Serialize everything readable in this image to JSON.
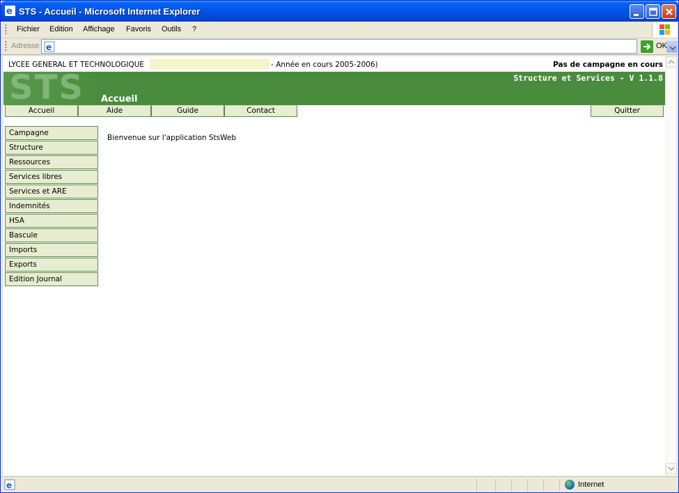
{
  "window": {
    "title": "STS - Accueil - Microsoft Internet Explorer"
  },
  "menu": {
    "items": [
      "Fichier",
      "Edition",
      "Affichage",
      "Favoris",
      "Outils",
      "?"
    ]
  },
  "address_bar": {
    "label": "Adresse",
    "value": "",
    "go_label": "OK"
  },
  "page": {
    "school": "LYCEE GENERAL ET TECHNOLOGIQUE",
    "year": "- Année en cours 2005-2006)",
    "campaign_status": "Pas de campagne en cours",
    "logo_text": "STS",
    "version": "Structure et Services - V 1.1.8",
    "heading": "Accueil",
    "top_nav": [
      "Accueil",
      "Aide",
      "Guide",
      "Contact"
    ],
    "quit_label": "Quitter",
    "sidebar": [
      "Campagne",
      "Structure",
      "Ressources",
      "Services libres",
      "Services et ARE",
      "Indemnités",
      "HSA",
      "Bascule",
      "Imports",
      "Exports",
      "Edition Journal"
    ],
    "welcome": "Bienvenue sur l'application StsWeb"
  },
  "status_bar": {
    "zone": "Internet"
  },
  "colors": {
    "banner_green": "#4a8c3d",
    "button_fill": "#e6edd0",
    "xp_blue": "#0055e5"
  }
}
